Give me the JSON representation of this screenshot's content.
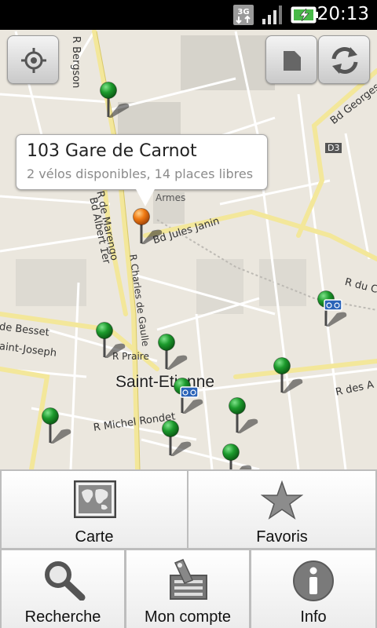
{
  "status": {
    "time": "20:13",
    "network": "3G"
  },
  "map": {
    "streets": {
      "bergson": "R Bergson",
      "georges": "Bd Georges",
      "d3": "D3",
      "marengo": "R de Marengo",
      "albert": "Bd Albert 1er",
      "gaulle": "R Charles de Gaulle",
      "janin": "Bd Jules Janin",
      "armes": "Armes",
      "besset": "de Besset",
      "joseph": "aint-Joseph",
      "prairie": "R Praire",
      "city": "Saint-Etienne",
      "rondet": "R Michel Rondet",
      "rdesa": "R des A",
      "rdu": "R du C"
    },
    "callout": {
      "title": "103 Gare de Carnot",
      "subtitle": "2 vélos disponibles, 14 places libres"
    },
    "buttons": {
      "locate": "locate-icon",
      "layers": "layers-icon",
      "refresh": "refresh-icon"
    },
    "colors": {
      "marker_green": "#1c9a2c",
      "marker_selected": "#f07a12",
      "station_blue": "#2a63b8"
    }
  },
  "menu": {
    "items": [
      {
        "label": "Carte",
        "icon": "map-icon"
      },
      {
        "label": "Favoris",
        "icon": "star-icon"
      },
      {
        "label": "Recherche",
        "icon": "search-icon"
      },
      {
        "label": "Mon compte",
        "icon": "account-card-icon"
      },
      {
        "label": "Info",
        "icon": "info-icon"
      }
    ]
  }
}
